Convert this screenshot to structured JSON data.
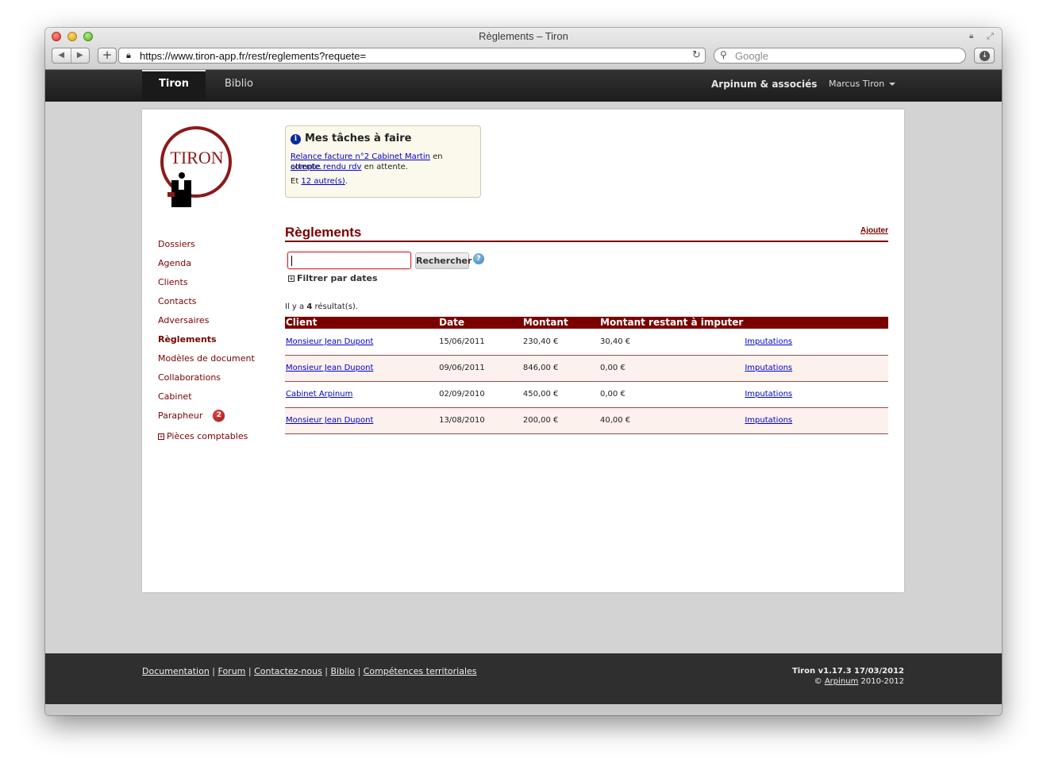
{
  "browser": {
    "window_title": "Règlements – Tiron",
    "url": "https://www.tiron-app.fr/rest/reglements?requete=",
    "search_placeholder": "Google"
  },
  "nav": {
    "tabs": [
      {
        "label": "Tiron",
        "active": true
      },
      {
        "label": "Biblio",
        "active": false
      }
    ],
    "firm": "Arpinum & associés",
    "user": "Marcus Tiron"
  },
  "logo": {
    "text": "TIRON",
    "color": "#8b1a1a"
  },
  "sidebar": {
    "items": [
      {
        "label": "Dossiers"
      },
      {
        "label": "Agenda"
      },
      {
        "label": "Clients"
      },
      {
        "label": "Contacts"
      },
      {
        "label": "Adversaires"
      },
      {
        "label": "Règlements",
        "active": true
      },
      {
        "label": "Modèles de document"
      },
      {
        "label": "Collaborations"
      },
      {
        "label": "Cabinet"
      },
      {
        "label": "Parapheur",
        "badge": "2"
      },
      {
        "label": "Pièces comptables",
        "expandable": true
      }
    ]
  },
  "tasks": {
    "title": "Mes tâches à faire",
    "items": [
      {
        "link": "Relance facture n°2 Cabinet Martin",
        "suffix": " en attente."
      },
      {
        "link": "compte rendu rdv",
        "suffix": " en attente."
      }
    ],
    "more_prefix": "Et ",
    "more_link": "12 autre(s)",
    "more_suffix": "."
  },
  "section": {
    "title": "Règlements",
    "add_label": "Ajouter",
    "search_button": "Rechercher",
    "filter_label": "Filtrer par dates",
    "results_prefix": "Il y a ",
    "results_count": "4",
    "results_suffix": " résultat(s)."
  },
  "table": {
    "headers": [
      "Client",
      "Date",
      "Montant",
      "Montant restant à imputer",
      ""
    ],
    "rows": [
      {
        "client": "Monsieur Jean Dupont",
        "date": "15/06/2011",
        "montant": "230,40 €",
        "restant": "30,40 €",
        "action": "Imputations"
      },
      {
        "client": "Monsieur Jean Dupont",
        "date": "09/06/2011",
        "montant": "846,00 €",
        "restant": "0,00 €",
        "action": "Imputations"
      },
      {
        "client": "Cabinet Arpinum",
        "date": "02/09/2010",
        "montant": "450,00 €",
        "restant": "0,00 €",
        "action": "Imputations"
      },
      {
        "client": "Monsieur Jean Dupont",
        "date": "13/08/2010",
        "montant": "200,00 €",
        "restant": "40,00 €",
        "action": "Imputations"
      }
    ]
  },
  "footer": {
    "links": [
      "Documentation",
      "Forum",
      "Contactez-nous",
      "Biblio",
      "Compétences territoriales"
    ],
    "separator": " | ",
    "version": "Tiron v1.17.3 17/03/2012",
    "copyright_prefix": "© ",
    "copyright_link": "Arpinum",
    "copyright_suffix": " 2010-2012"
  },
  "colors": {
    "brand": "#7a0000",
    "link": "#0000c8",
    "nav_bg": "#1c1c1c",
    "footer_bg": "#2f2f2f"
  }
}
